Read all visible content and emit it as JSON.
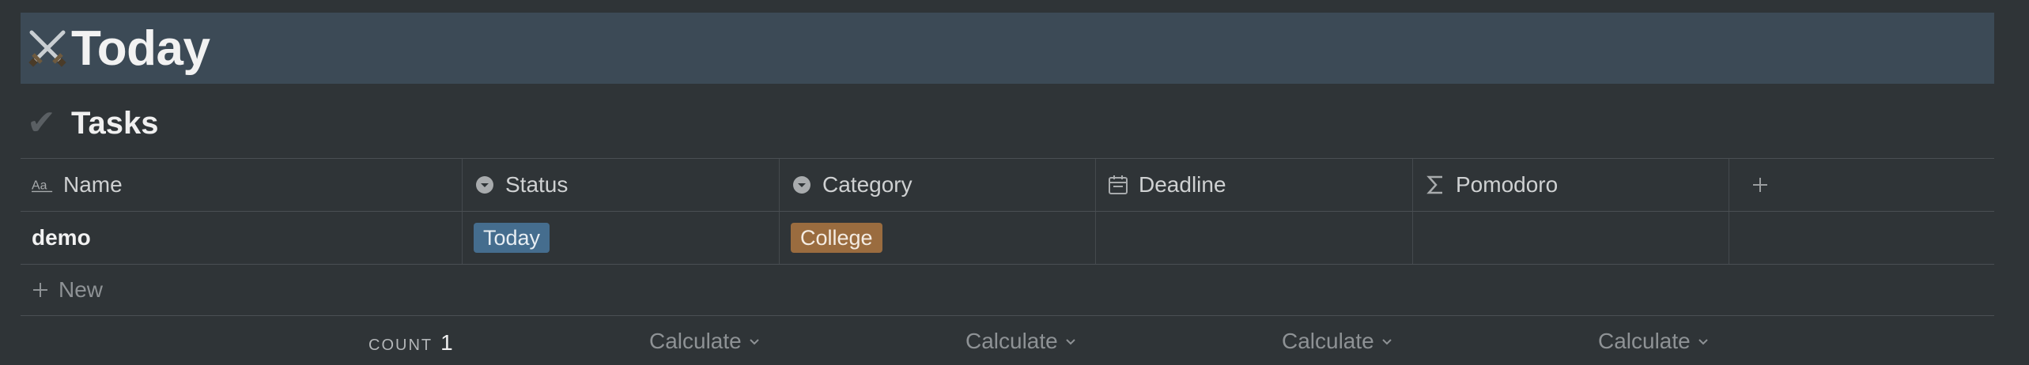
{
  "page": {
    "title": "Today",
    "title_icon": "crossed-swords-icon"
  },
  "section": {
    "icon": "checkmark-icon",
    "heading": "Tasks"
  },
  "table": {
    "columns": [
      {
        "label": "Name",
        "icon": "text-property-icon"
      },
      {
        "label": "Status",
        "icon": "select-property-icon"
      },
      {
        "label": "Category",
        "icon": "select-property-icon"
      },
      {
        "label": "Deadline",
        "icon": "calendar-icon"
      },
      {
        "label": "Pomodoro",
        "icon": "sigma-formula-icon"
      }
    ],
    "add_column_icon": "plus-icon",
    "rows": [
      {
        "name": "demo",
        "status": "Today",
        "category": "College",
        "deadline": "",
        "pomodoro": ""
      }
    ],
    "new_label": "New",
    "footer": {
      "count_label": "COUNT",
      "count_value": "1",
      "calculate_label": "Calculate"
    }
  },
  "colors": {
    "background": "#2f3437",
    "banner": "#3c4a56",
    "status_tag": "#456d8e",
    "category_tag": "#9a6c3f"
  }
}
